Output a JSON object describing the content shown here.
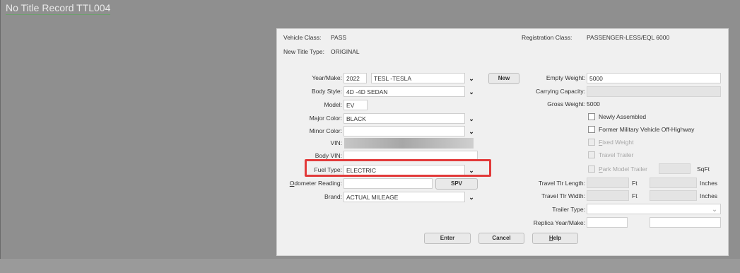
{
  "page": {
    "title": "No Title Record TTL004"
  },
  "header": {
    "vehicle_class_label": "Vehicle Class:",
    "vehicle_class_value": "PASS",
    "new_title_type_label": "New Title Type:",
    "new_title_type_value": "ORIGINAL",
    "registration_class_label": "Registration Class:",
    "registration_class_value": "PASSENGER-LESS/EQL 6000"
  },
  "left": {
    "year_make_label": "Year/Make:",
    "year_value": "2022",
    "make_value": "TESL -TESLA",
    "new_button": "New",
    "body_style_label": "Body Style:",
    "body_style_value": "4D -4D SEDAN",
    "model_label": "Model:",
    "model_value": "EV",
    "major_color_label": "Major Color:",
    "major_color_value": "BLACK",
    "minor_color_label": "Minor Color:",
    "minor_color_value": "",
    "vin_label": "VIN:",
    "vin_value": "",
    "body_vin_label": "Body VIN:",
    "body_vin_value": "",
    "fuel_type_label": "Fuel Type:",
    "fuel_type_value": "ELECTRIC",
    "odometer_label_prefix": "O",
    "odometer_label_rest": "dometer Reading:",
    "odometer_value": "",
    "spv_button": "SPV",
    "brand_label": "Brand:",
    "brand_value": "ACTUAL MILEAGE"
  },
  "right": {
    "empty_weight_label": "Empty Weight:",
    "empty_weight_value": "5000",
    "carrying_capacity_label": "Carrying Capacity:",
    "carrying_capacity_value": "",
    "gross_weight_label": "Gross Weight:",
    "gross_weight_value": "5000",
    "newly_assembled": "Newly Assembled",
    "former_military": "Former Military Vehicle Off-Highway",
    "fixed_weight_prefix": "F",
    "fixed_weight_rest": "ixed Weight",
    "travel_trailer": "Travel Trailer",
    "park_model_prefix": "P",
    "park_model_rest": "ark Model Trailer",
    "sqft_unit": "SqFt",
    "travel_tlr_length_label": "Travel Tlr Length:",
    "travel_tlr_width_label": "Travel Tlr Width:",
    "ft_unit": "Ft",
    "inches_unit": "Inches",
    "trailer_type_label": "Trailer Type:",
    "trailer_type_value": "",
    "replica_label": "Replica Year/Make:"
  },
  "footer": {
    "enter_button": "Enter",
    "cancel_button": "Cancel",
    "help_prefix": "H",
    "help_rest": "elp"
  },
  "colors": {
    "highlight": "#e23a3a",
    "background": "#8f8f8f",
    "dialog": "#f0f0f0"
  }
}
